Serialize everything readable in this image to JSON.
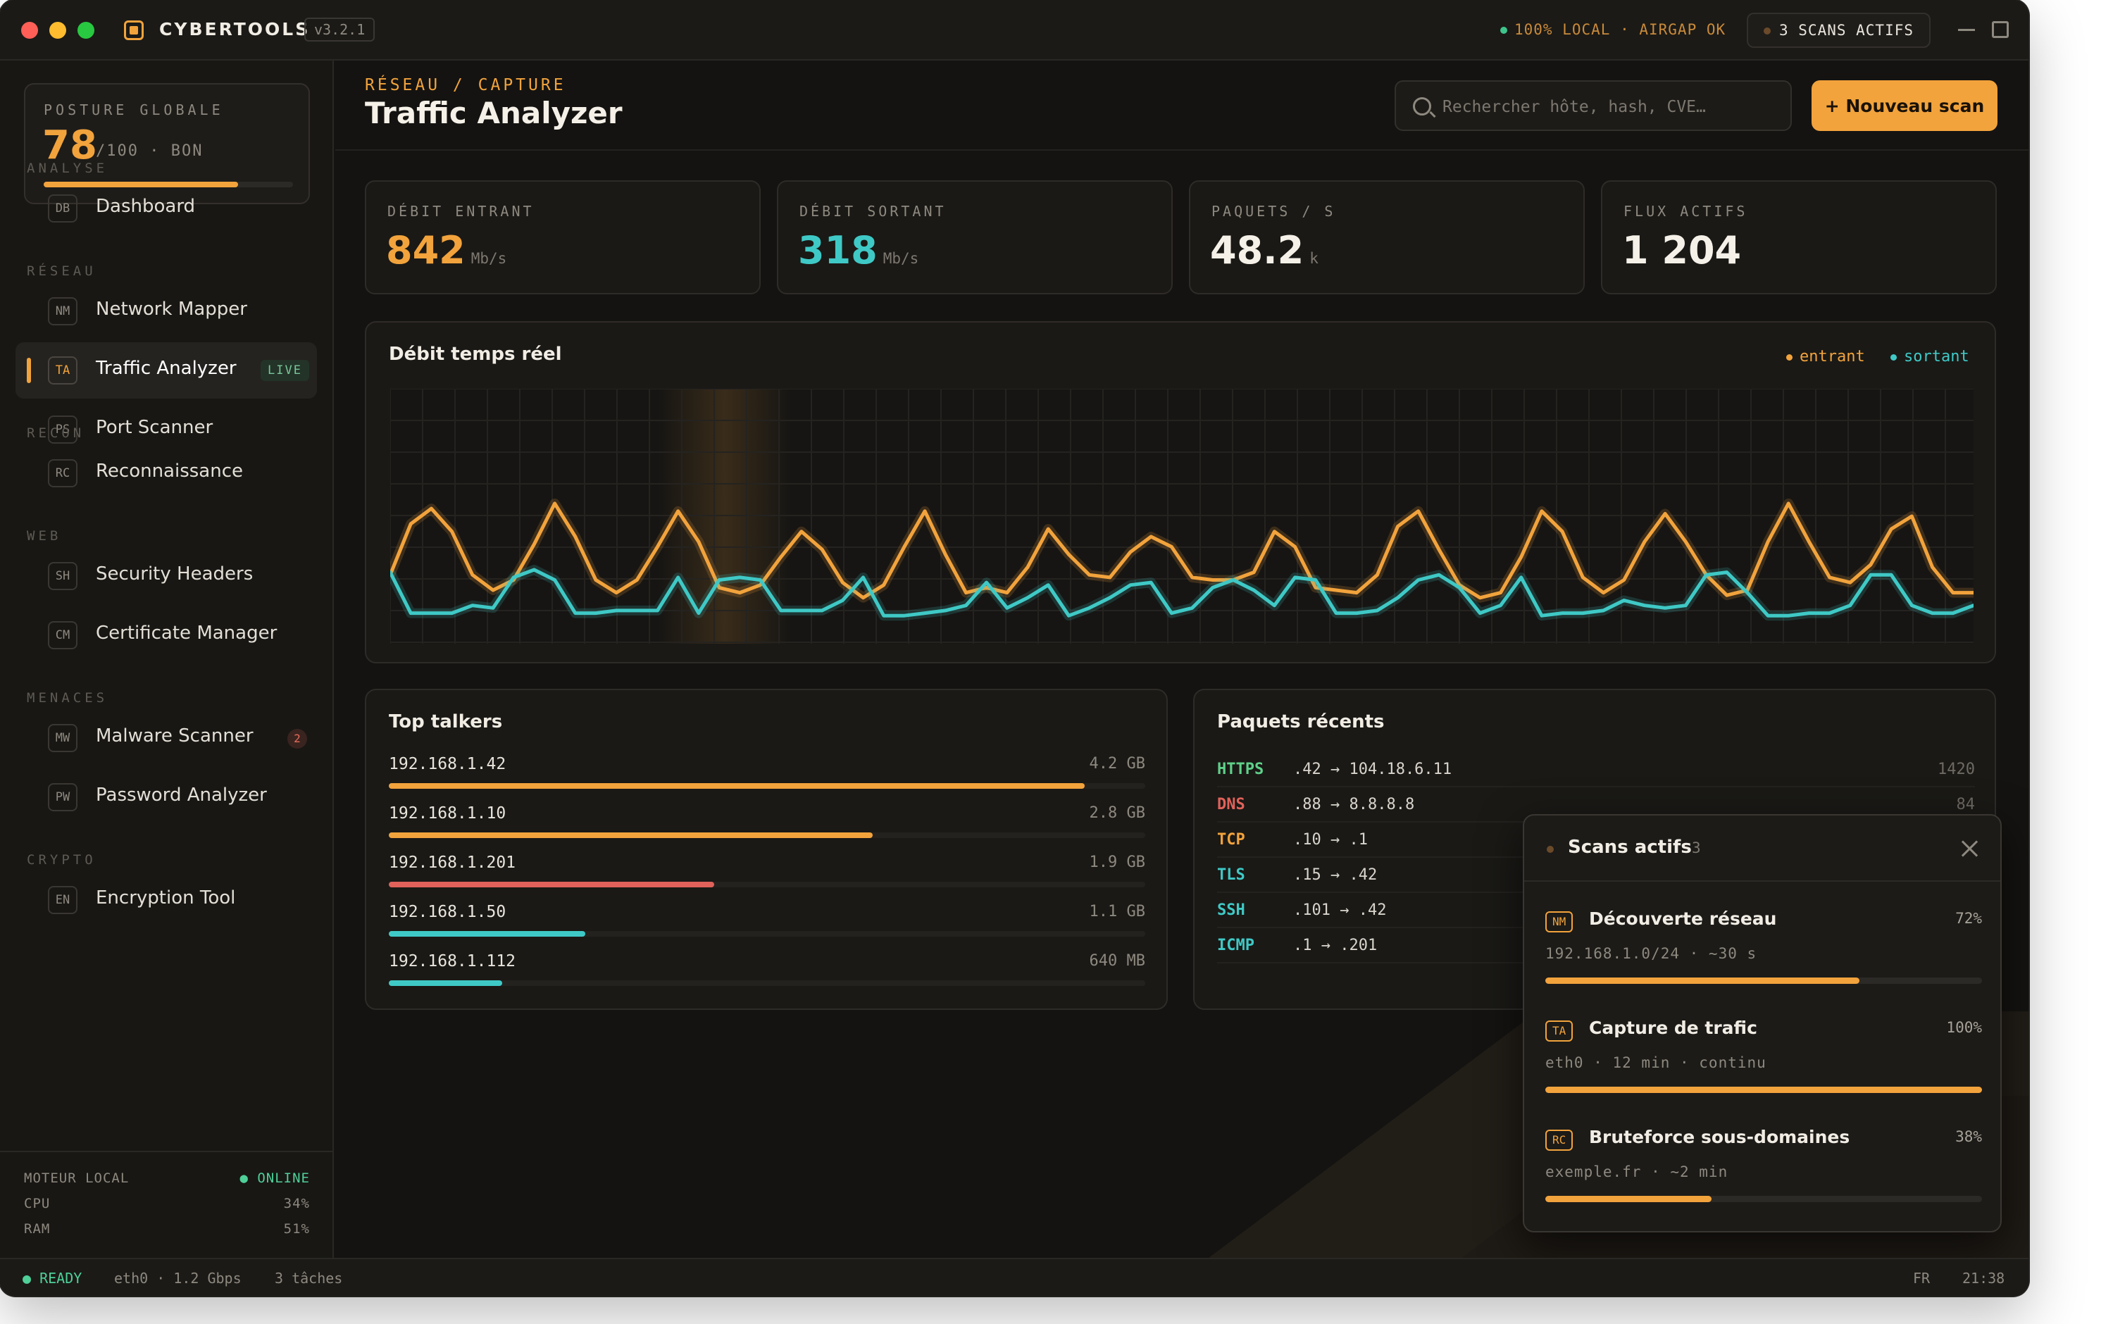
{
  "app": {
    "name": "CYBERTOOLS",
    "version": "v3.2.1",
    "local_status": "100% LOCAL · AIRGAP OK",
    "active_scans_label": "3 SCANS ACTIFS"
  },
  "posture": {
    "label": "POSTURE GLOBALE",
    "score": "78",
    "suffix": "/100 · BON",
    "progress": 0.78
  },
  "sidebar": {
    "sections": [
      {
        "label": "ANALYSE",
        "items": [
          {
            "code": "DB",
            "label": "Dashboard"
          }
        ]
      },
      {
        "label": "RÉSEAU",
        "items": [
          {
            "code": "NM",
            "label": "Network Mapper"
          },
          {
            "code": "TA",
            "label": "Traffic Analyzer",
            "tag": "LIVE",
            "active": true
          },
          {
            "code": "PS",
            "label": "Port Scanner"
          }
        ]
      },
      {
        "label": "RECON",
        "items": [
          {
            "code": "RC",
            "label": "Reconnaissance"
          }
        ]
      },
      {
        "label": "WEB",
        "items": [
          {
            "code": "SH",
            "label": "Security Headers"
          },
          {
            "code": "CM",
            "label": "Certificate Manager"
          }
        ]
      },
      {
        "label": "MENACES",
        "items": [
          {
            "code": "MW",
            "label": "Malware Scanner",
            "count": "2"
          },
          {
            "code": "PW",
            "label": "Password Analyzer"
          }
        ]
      },
      {
        "label": "CRYPTO",
        "items": [
          {
            "code": "EN",
            "label": "Encryption Tool"
          }
        ]
      }
    ]
  },
  "engine": {
    "label": "MOTEUR LOCAL",
    "status": "● ONLINE",
    "cpu_label": "CPU",
    "cpu": "34%",
    "ram_label": "RAM",
    "ram": "51%"
  },
  "header": {
    "breadcrumb": "RÉSEAU / CAPTURE",
    "title": "Traffic Analyzer",
    "search_placeholder": "Rechercher hôte, hash, CVE…",
    "new_scan_label": "+ Nouveau scan"
  },
  "stats": [
    {
      "label": "DÉBIT ENTRANT",
      "value": "842",
      "unit": "Mb/s",
      "color": "#f2a33c"
    },
    {
      "label": "DÉBIT SORTANT",
      "value": "318",
      "unit": "Mb/s",
      "color": "#3fc9c6"
    },
    {
      "label": "PAQUETS / S",
      "value": "48.2",
      "unit": "k",
      "color": "#f5f1e8"
    },
    {
      "label": "FLUX ACTIFS",
      "value": "1 204",
      "unit": "",
      "color": "#f5f1e8"
    }
  ],
  "chart_data": {
    "type": "line",
    "title": "Débit temps réel",
    "xlabel": "",
    "ylabel": "",
    "grid": true,
    "legend": "top-right",
    "ylim": [
      0,
      100
    ],
    "series": [
      {
        "name": "entrant",
        "color": "#f2a33c",
        "values": [
          27,
          47,
          53,
          44,
          27,
          21,
          25,
          39,
          55,
          42,
          25,
          20,
          25,
          38,
          52,
          40,
          22,
          20,
          23,
          34,
          44,
          37,
          24,
          18,
          23,
          38,
          52,
          35,
          20,
          22,
          20,
          30,
          45,
          35,
          27,
          26,
          36,
          42,
          38,
          26,
          25,
          25,
          28,
          44,
          38,
          22,
          21,
          20,
          27,
          46,
          52,
          37,
          23,
          18,
          20,
          34,
          52,
          44,
          26,
          20,
          25,
          40,
          51,
          40,
          27,
          19,
          21,
          40,
          55,
          40,
          26,
          24,
          31,
          45,
          50,
          30,
          20,
          20
        ]
      },
      {
        "name": "sortant",
        "color": "#3fc9c6",
        "values": [
          28,
          12,
          12,
          12,
          15,
          14,
          26,
          29,
          25,
          12,
          12,
          13,
          13,
          13,
          26,
          12,
          25,
          26,
          25,
          13,
          13,
          13,
          17,
          26,
          11,
          11,
          12,
          13,
          15,
          24,
          14,
          18,
          23,
          11,
          14,
          18,
          23,
          24,
          12,
          14,
          22,
          25,
          21,
          15,
          26,
          25,
          12,
          12,
          13,
          18,
          25,
          27,
          22,
          12,
          15,
          26,
          11,
          12,
          12,
          13,
          17,
          15,
          14,
          15,
          27,
          28,
          20,
          11,
          11,
          12,
          12,
          15,
          27,
          27,
          15,
          12,
          12,
          15
        ]
      }
    ]
  },
  "talkers": {
    "title": "Top talkers",
    "items": [
      {
        "ip": "192.168.1.42",
        "volume": "4.2 GB",
        "share": 0.92,
        "color": "#f2a33c"
      },
      {
        "ip": "192.168.1.10",
        "volume": "2.8 GB",
        "share": 0.64,
        "color": "#f2a33c"
      },
      {
        "ip": "192.168.1.201",
        "volume": "1.9 GB",
        "share": 0.43,
        "color": "#e0625a"
      },
      {
        "ip": "192.168.1.50",
        "volume": "1.1 GB",
        "share": 0.26,
        "color": "#3fc9c6"
      },
      {
        "ip": "192.168.1.112",
        "volume": "640 MB",
        "share": 0.15,
        "color": "#3fc9c6"
      }
    ]
  },
  "packets": {
    "title": "Paquets récents",
    "items": [
      {
        "proto": "HTTPS",
        "route": ".42 → 104.18.6.11",
        "size": "1420",
        "color": "#5fd18a"
      },
      {
        "proto": "DNS",
        "route": ".88 → 8.8.8.8",
        "size": "84",
        "color": "#e0625a"
      },
      {
        "proto": "TCP",
        "route": ".10 → .1",
        "size": "",
        "color": "#f2a33c"
      },
      {
        "proto": "TLS",
        "route": ".15 → .42",
        "size": "",
        "color": "#3fc9c6"
      },
      {
        "proto": "SSH",
        "route": ".101 → .42",
        "size": "",
        "color": "#3fc9c6"
      },
      {
        "proto": "ICMP",
        "route": ".1 → .201",
        "size": "",
        "color": "#3fc9c6"
      }
    ]
  },
  "active_scans": {
    "title": "Scans actifs",
    "count": "3",
    "items": [
      {
        "code": "NM",
        "name": "Découverte réseau",
        "meta": "192.168.1.0/24 · ~30 s",
        "percent": "72%",
        "progress": 0.72
      },
      {
        "code": "TA",
        "name": "Capture de trafic",
        "meta": "eth0 · 12 min · continu",
        "percent": "100%",
        "progress": 1.0
      },
      {
        "code": "RC",
        "name": "Bruteforce sous-domaines",
        "meta": "exemple.fr · ~2 min",
        "percent": "38%",
        "progress": 0.38
      }
    ]
  },
  "statusbar": {
    "ready": "● READY",
    "iface": "eth0 · 1.2 Gbps",
    "tasks": "3 tâches",
    "lang": "FR",
    "time": "21:38"
  }
}
